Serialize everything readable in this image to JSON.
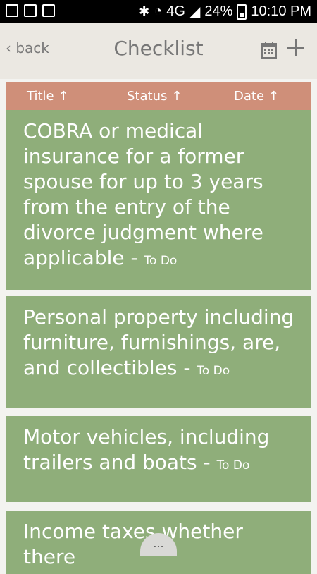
{
  "status_bar": {
    "network": "4G",
    "battery": "24%",
    "time": "10:10 PM"
  },
  "header": {
    "back_label": "‹ back",
    "title": "Checklist"
  },
  "sort": {
    "title_label": "Title",
    "status_label": "Status",
    "date_label": "Date",
    "arrow": "↑"
  },
  "items": [
    {
      "title": "COBRA or medical insurance for a former spouse for up to 3 years from the entry of the divorce judgment where applicable",
      "status": "To Do"
    },
    {
      "title": "Personal property including furniture, furnishings, are, and collectibles",
      "status": "To Do"
    },
    {
      "title": "Motor vehicles, including trailers and boats",
      "status": "To Do"
    },
    {
      "title": "Income taxes whether there",
      "status": ""
    }
  ],
  "more_label": "...",
  "colors": {
    "header_bg": "#ebe8e2",
    "sort_bar": "#cf8f79",
    "card": "#8fae7a"
  }
}
